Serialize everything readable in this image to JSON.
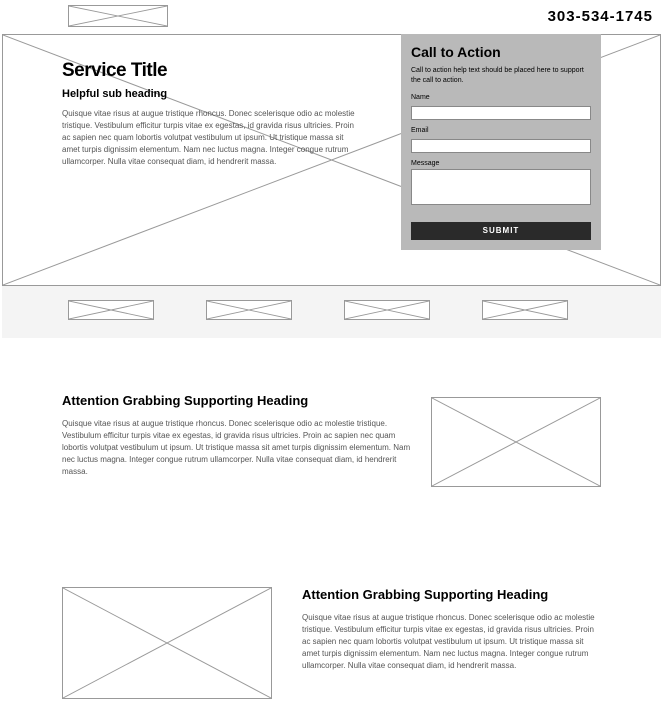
{
  "header": {
    "phone": "303-534-1745"
  },
  "hero": {
    "title": "Service Title",
    "subheading": "Helpful sub heading",
    "body": "Quisque vitae risus at augue tristique rhoncus. Donec scelerisque odio ac molestie tristique. Vestibulum efficitur turpis vitae ex egestas, id gravida risus ultricies. Proin ac sapien nec quam lobortis volutpat vestibulum ut ipsum. Ut tristique massa sit amet turpis dignissim elementum. Nam nec luctus magna. Integer congue rutrum ullamcorper. Nulla vitae consequat diam, id hendrerit massa."
  },
  "cta": {
    "heading": "Call to Action",
    "help": "Call to action help text should be placed here to support the call to action.",
    "name_label": "Name",
    "email_label": "Email",
    "message_label": "Message",
    "submit": "SUBMIT"
  },
  "feature1": {
    "heading": "Attention Grabbing Supporting Heading",
    "body": "Quisque vitae risus at augue tristique rhoncus. Donec scelerisque odio ac molestie tristique. Vestibulum efficitur turpis vitae ex egestas, id gravida risus ultricies. Proin ac sapien nec quam lobortis volutpat vestibulum ut ipsum. Ut tristique massa sit amet turpis dignissim elementum. Nam nec luctus magna. Integer congue rutrum ullamcorper. Nulla vitae consequat diam, id hendrerit massa."
  },
  "feature2": {
    "heading": "Attention Grabbing Supporting Heading",
    "body": "Quisque vitae risus at augue tristique rhoncus. Donec scelerisque odio ac molestie tristique. Vestibulum efficitur turpis vitae ex egestas, id gravida risus ultricies. Proin ac sapien nec quam lobortis volutpat vestibulum ut ipsum. Ut tristique massa sit amet turpis dignissim elementum. Nam nec luctus magna. Integer congue rutrum ullamcorper. Nulla vitae consequat diam, id hendrerit massa."
  }
}
